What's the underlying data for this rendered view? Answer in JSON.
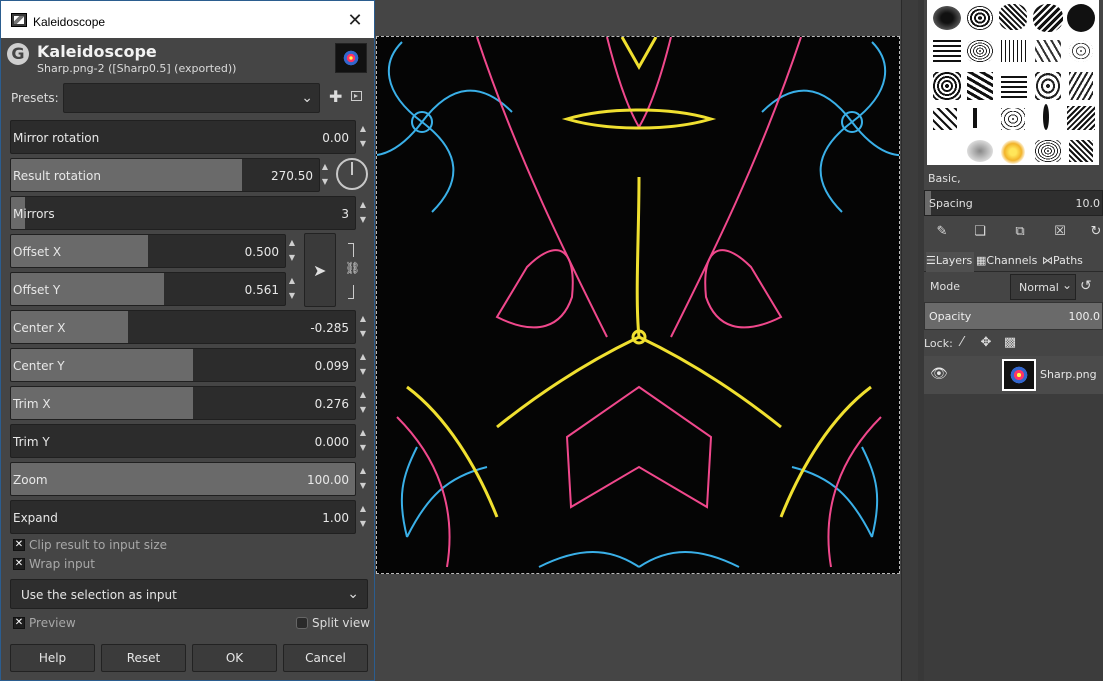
{
  "dialog": {
    "window_title": "Kaleidoscope",
    "close_glyph": "✕",
    "heading": "Kaleidoscope",
    "subheading": "Sharp.png-2 ([Sharp0.5] (exported))",
    "logo_letter": "G",
    "presets": {
      "label": "Presets:",
      "value": ""
    },
    "sliders": {
      "mirror_rotation": {
        "label": "Mirror rotation",
        "value": "0.00",
        "fraction": 0.0
      },
      "result_rotation": {
        "label": "Result rotation",
        "value": "270.50",
        "fraction": 0.75
      },
      "mirrors": {
        "label": "Mirrors",
        "value": "3",
        "fraction": 0.04
      },
      "offset_x": {
        "label": "Offset X",
        "value": "0.500",
        "fraction": 0.5
      },
      "offset_y": {
        "label": "Offset Y",
        "value": "0.561",
        "fraction": 0.56
      },
      "center_x": {
        "label": "Center X",
        "value": "-0.285",
        "fraction": 0.34
      },
      "center_y": {
        "label": "Center Y",
        "value": "0.099",
        "fraction": 0.53
      },
      "trim_x": {
        "label": "Trim X",
        "value": "0.276",
        "fraction": 0.53
      },
      "trim_y": {
        "label": "Trim Y",
        "value": "0.000",
        "fraction": 0.0
      },
      "zoom": {
        "label": "Zoom",
        "value": "100.00",
        "fraction": 1.0
      },
      "expand": {
        "label": "Expand",
        "value": "1.00",
        "fraction": 0.0
      }
    },
    "checkboxes": {
      "clip_result": {
        "label": "Clip result to input size",
        "checked": true
      },
      "wrap_input": {
        "label": "Wrap input",
        "checked": true
      },
      "preview": {
        "label": "Preview",
        "checked": true
      },
      "split_view": {
        "label": "Split view",
        "checked": false
      }
    },
    "input_mode": {
      "value": "Use the selection as input"
    },
    "buttons": {
      "help": "Help",
      "reset": "Reset",
      "ok": "OK",
      "cancel": "Cancel"
    }
  },
  "dock": {
    "brush_name": "Basic,",
    "spacing": {
      "label": "Spacing",
      "value": "10.0"
    },
    "tabs": [
      {
        "label": "Layers"
      },
      {
        "label": "Channels"
      },
      {
        "label": "Paths"
      }
    ],
    "mode": {
      "label": "Mode",
      "value": "Normal"
    },
    "opacity": {
      "label": "Opacity",
      "value": "100.0"
    },
    "lock": {
      "label": "Lock:"
    },
    "layer": {
      "name": "Sharp.png"
    }
  },
  "colors": {
    "accent_pink": "#f0488c",
    "accent_yellow": "#f0e030",
    "accent_blue": "#3ab0e8"
  }
}
